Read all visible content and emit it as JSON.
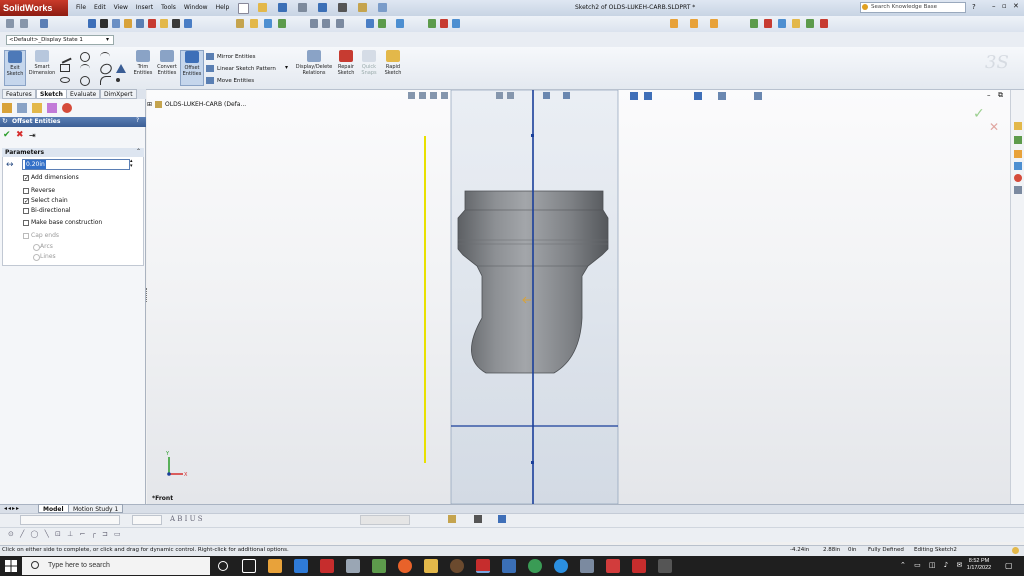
{
  "app": {
    "name": "SolidWorks",
    "document_title": "Sketch2 of OLDS-LUKEH-CARB.SLDPRT *"
  },
  "menu": [
    "File",
    "Edit",
    "View",
    "Insert",
    "Tools",
    "Window",
    "Help"
  ],
  "search": {
    "placeholder": "Search Knowledge Base"
  },
  "config_combo": "<Default>_Display State 1",
  "command_manager": {
    "exit_sketch": "Exit Sketch",
    "smart_dimension": "Smart Dimension",
    "trim_entities": "Trim Entities",
    "convert_entities": "Convert Entities",
    "offset_entities": "Offset Entities",
    "mirror_entities": "Mirror Entities",
    "linear_sketch_pattern": "Linear Sketch Pattern",
    "move_entities": "Move Entities",
    "display_delete_relations": "Display/Delete Relations",
    "repair_sketch": "Repair Sketch",
    "quick_snaps": "Quick Snaps",
    "rapid_sketch": "Rapid Sketch"
  },
  "tabs": [
    "Features",
    "Sketch",
    "Evaluate",
    "DimXpert"
  ],
  "active_tab": "Sketch",
  "property_manager": {
    "title": "Offset Entities",
    "parameters_header": "Parameters",
    "offset_value": "0.20in",
    "options": [
      {
        "label": "Add dimensions",
        "checked": true,
        "enabled": true
      },
      {
        "label": "Reverse",
        "checked": false,
        "enabled": true
      },
      {
        "label": "Select chain",
        "checked": true,
        "enabled": true
      },
      {
        "label": "Bi-directional",
        "checked": false,
        "enabled": true
      },
      {
        "label": "Make base construction",
        "checked": false,
        "enabled": true
      },
      {
        "label": "Cap ends",
        "checked": false,
        "enabled": false
      }
    ],
    "cap_options": [
      {
        "label": "Arcs",
        "selected": true
      },
      {
        "label": "Lines",
        "selected": false
      }
    ]
  },
  "feature_tree_root": "OLDS-LUKEH-CARB (Defa...",
  "view_label": "*Front",
  "bottom_tabs": [
    "Model",
    "Motion Study 1"
  ],
  "status": {
    "message": "Click on either side to complete, or click and drag for dynamic control.  Right-click for additional options.",
    "x": "-4.24in",
    "y": "2.88in",
    "z": "0in",
    "state": "Fully Defined",
    "mode": "Editing Sketch2"
  },
  "taskbar": {
    "search_placeholder": "Type here to search",
    "time": "8:52 PM",
    "date": "1/17/2022"
  },
  "colors": {
    "accent": "#3c5f95",
    "sketch_line": "#1a3f9a",
    "yellow_line": "#e8e000",
    "part": "#8a8c8f"
  }
}
